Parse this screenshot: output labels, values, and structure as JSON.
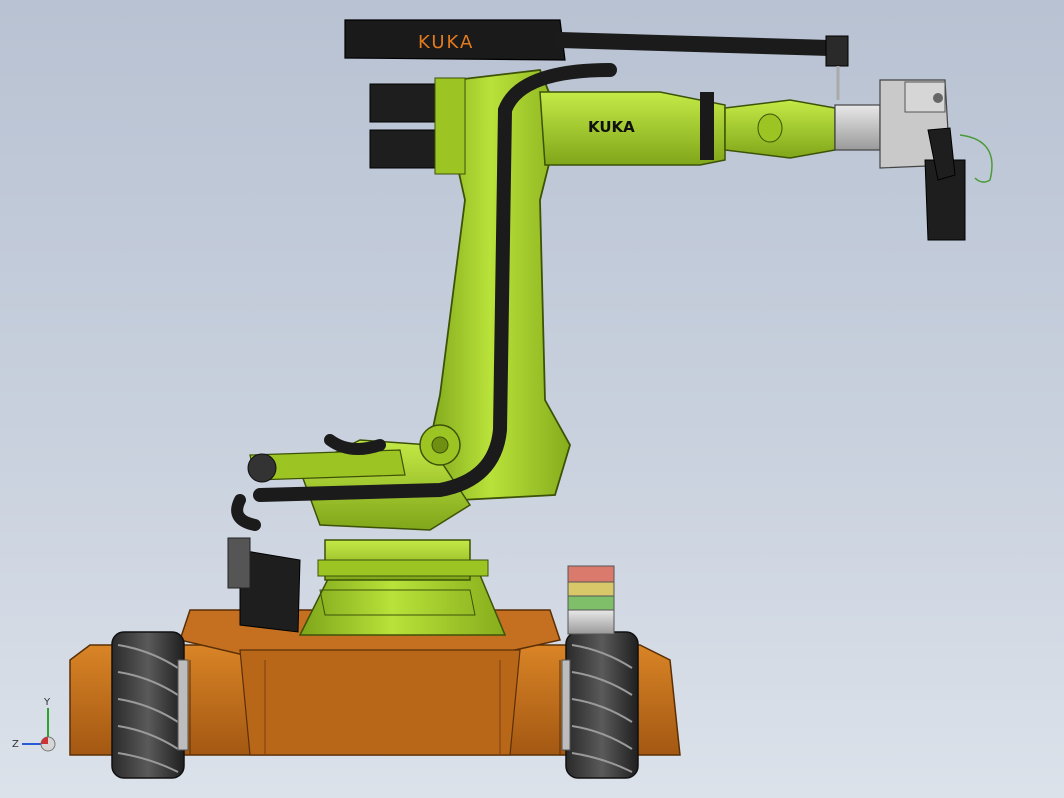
{
  "viewport": {
    "background_top": "#b8c2d2",
    "background_bottom": "#dce2ea"
  },
  "model": {
    "brand_label_upper": "KUKA",
    "brand_label_arm": "KUKA",
    "colors": {
      "robot_green": "#a6d12a",
      "robot_green_dark": "#6e8f12",
      "base_orange": "#c8741c",
      "base_orange_dark": "#8a4a0c",
      "cable_black": "#1b1b1b",
      "motor_black": "#222222",
      "brand_orange": "#e07b1f",
      "light_red": "#d97a6c",
      "light_yellow": "#d9c86a",
      "light_green": "#7fbf6a",
      "metal_grey": "#c9c9c9"
    }
  },
  "triad": {
    "y_label": "Y",
    "z_label": "Z"
  }
}
